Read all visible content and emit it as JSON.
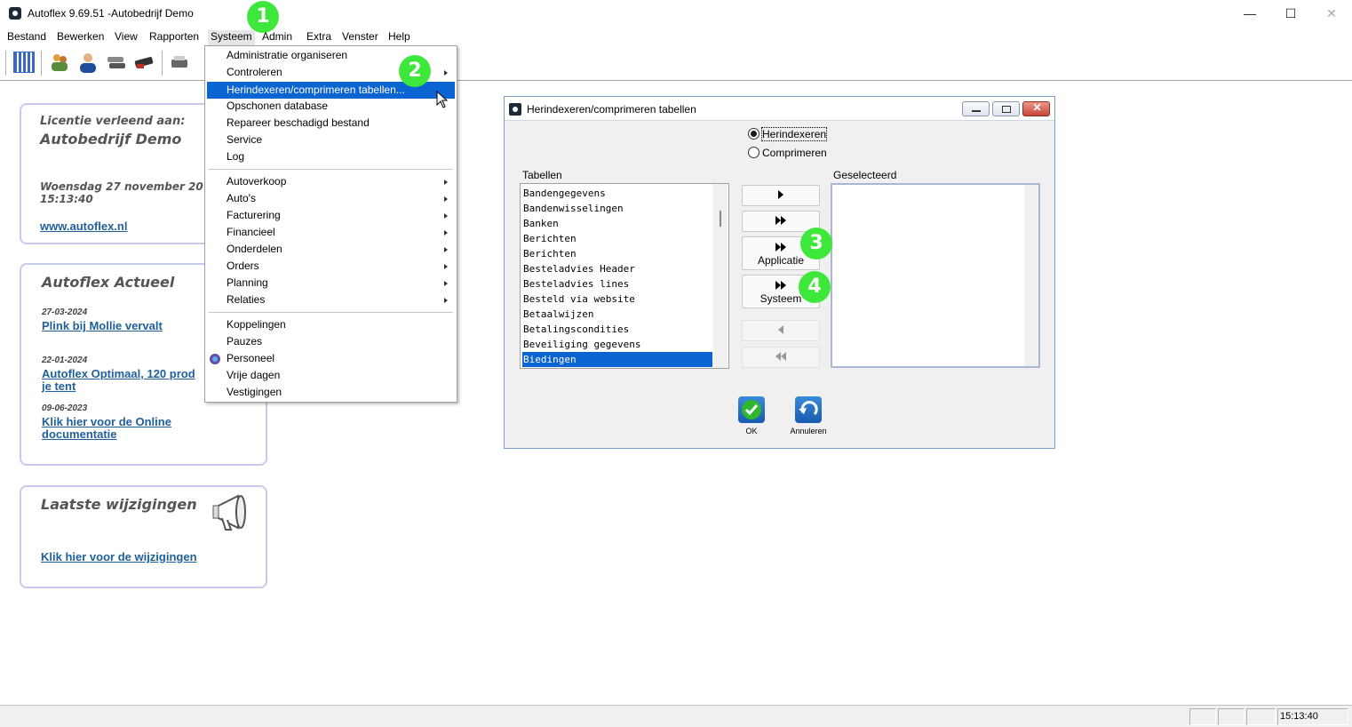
{
  "window": {
    "title": "Autoflex 9.69.51 -Autobedrijf Demo",
    "minimize": "—",
    "maximize": "☐",
    "close": "✕"
  },
  "menubar": [
    "Bestand",
    "Bewerken",
    "View",
    "Rapporten",
    "Systeem",
    "Admin",
    "Extra",
    "Venster",
    "Help"
  ],
  "license_panel": {
    "heading": "Licentie verleend aan:",
    "company": "Autobedrijf Demo",
    "date": "Woensdag 27 november 20",
    "time": "15:13:40",
    "link": "www.autoflex.nl"
  },
  "news_panel": {
    "heading": "Autoflex Actueel",
    "items": [
      {
        "date": "27-03-2024",
        "title": "Plink bij Mollie vervalt",
        "title2": ""
      },
      {
        "date": "22-01-2024",
        "title": "Autoflex Optimaal, 120 prod",
        "title2": "je tent"
      },
      {
        "date": "09-06-2023",
        "title": "Klik hier voor de Online ",
        "title2": "documentatie"
      }
    ]
  },
  "changes_panel": {
    "heading": "Laatste wijzigingen",
    "link": "Klik hier voor de wijzigingen"
  },
  "systeem_menu": {
    "group1": [
      {
        "label": "Administratie organiseren",
        "submenu": false
      },
      {
        "label": "Controleren",
        "submenu": true
      },
      {
        "label": "Herindexeren/comprimeren tabellen...",
        "submenu": false,
        "highlighted": true
      },
      {
        "label": "Opschonen database",
        "submenu": false
      },
      {
        "label": "Repareer beschadigd bestand",
        "submenu": false
      },
      {
        "label": "Service",
        "submenu": false
      },
      {
        "label": "Log",
        "submenu": false
      }
    ],
    "group2": [
      {
        "label": "Autoverkoop",
        "submenu": true
      },
      {
        "label": "Auto's",
        "submenu": true
      },
      {
        "label": "Facturering",
        "submenu": true
      },
      {
        "label": "Financieel",
        "submenu": true
      },
      {
        "label": "Onderdelen",
        "submenu": true
      },
      {
        "label": "Orders",
        "submenu": true
      },
      {
        "label": "Planning",
        "submenu": true
      },
      {
        "label": "Relaties",
        "submenu": true
      }
    ],
    "group3": [
      {
        "label": "Koppelingen"
      },
      {
        "label": "Pauzes"
      },
      {
        "label": "Personeel"
      },
      {
        "label": "Vrije dagen"
      },
      {
        "label": "Vestigingen"
      }
    ]
  },
  "dialog": {
    "title": "Herindexeren/comprimeren tabellen",
    "radio_reindex": "Herindexeren",
    "radio_compress": "Comprimeren",
    "selected_mode": "Herindexeren",
    "tables_label": "Tabellen",
    "selected_label": "Geselecteerd",
    "tables": [
      "Bandengegevens",
      "Bandenwisselingen",
      "Banken",
      "Berichten",
      "Berichten",
      "Besteladvies Header",
      "Besteladvies lines",
      "Besteld via website",
      "Betaalwijzen",
      "Betalingscondities",
      "Beveiliging gegevens",
      "Biedingen"
    ],
    "selected_table": "Biedingen",
    "selected_items": [],
    "btn_application": "Applicatie",
    "btn_system": "Systeem",
    "ok": "OK",
    "cancel": "Annuleren"
  },
  "callouts": [
    "1",
    "2",
    "3",
    "4"
  ],
  "colors": {
    "highlight": "#0a64d2",
    "callout": "#3ee83a",
    "panel_border": "#c5cbe8",
    "link": "#1f5f9a"
  },
  "statusbar": {
    "time": "15:13:40"
  }
}
